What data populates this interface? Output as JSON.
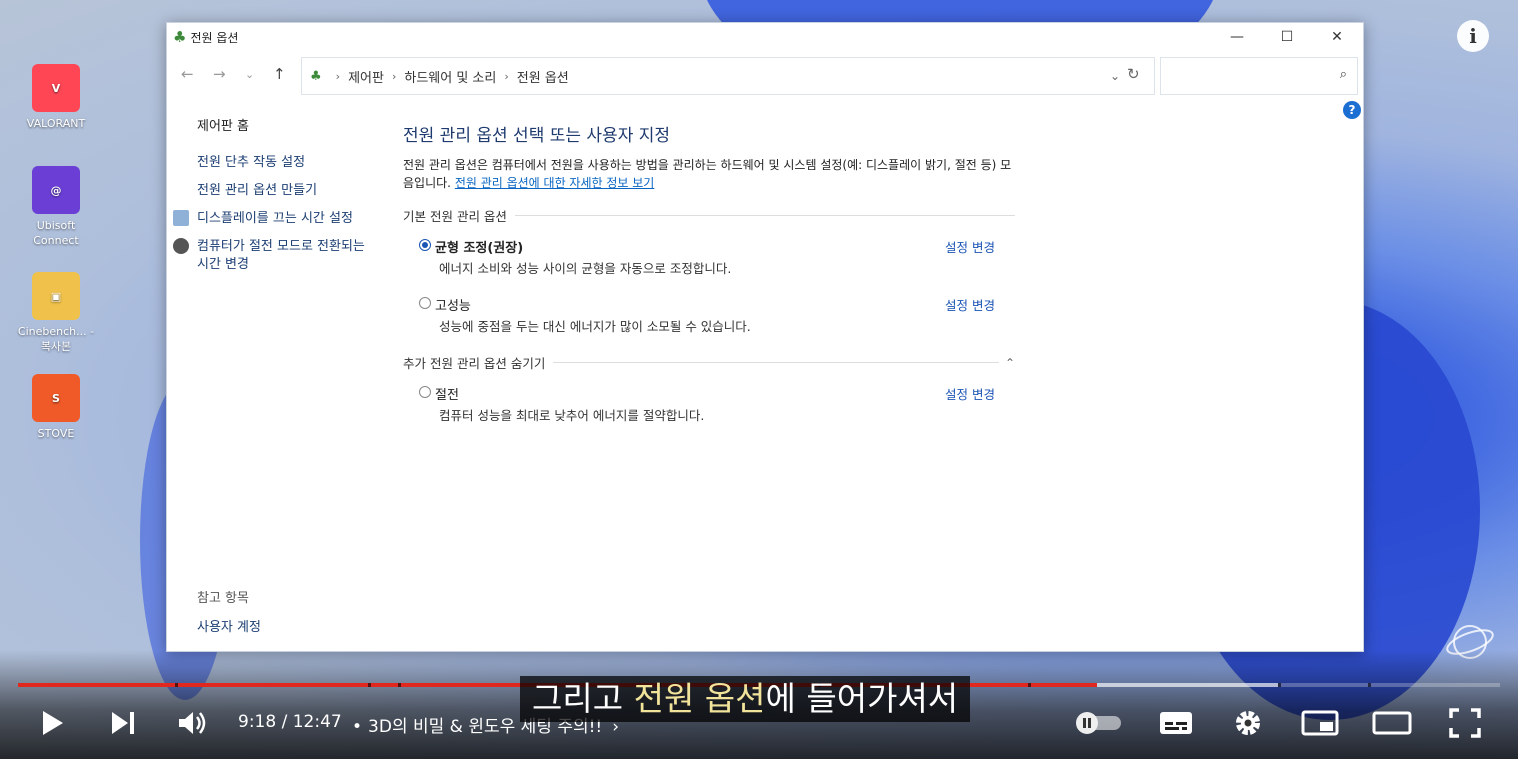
{
  "desktop": {
    "icons": [
      {
        "label": "VALORANT",
        "glyph": "V",
        "color": "#ff4655"
      },
      {
        "label": "Ubisoft Connect",
        "glyph": "@",
        "color": "#6b3fd6"
      },
      {
        "label": "Cinebench... - 복사본",
        "glyph": "▣",
        "color": "#f0c24b"
      },
      {
        "label": "STOVE",
        "glyph": "S",
        "color": "#f05a28"
      }
    ]
  },
  "window": {
    "title": "전원 옵션",
    "controls": {
      "minimize": "—",
      "maximize": "☐",
      "close": "✕"
    },
    "address": [
      "제어판",
      "하드웨어 및 소리",
      "전원 옵션"
    ]
  },
  "sidebar": {
    "home": "제어판 홈",
    "links": [
      "전원 단추 작동 설정",
      "전원 관리 옵션 만들기",
      "디스플레이를 끄는 시간 설정",
      "컴퓨터가 절전 모드로 전환되는 시간 변경"
    ],
    "see_also_heading": "참고 항목",
    "see_also_link": "사용자 계정"
  },
  "main": {
    "heading": "전원 관리 옵션 선택 또는 사용자 지정",
    "description": "전원 관리 옵션은 컴퓨터에서 전원을 사용하는 방법을 관리하는 하드웨어 및 시스템 설정(예: 디스플레이 밝기, 절전 등) 모음입니다.",
    "more_info_link": "전원 관리 옵션에 대한 자세한 정보 보기",
    "basic_group": "기본 전원 관리 옵션",
    "extra_group": "추가 전원 관리 옵션 숨기기",
    "change_label": "설정 변경",
    "plans": [
      {
        "name": "균형 조정(권장)",
        "desc": "에너지 소비와 성능 사이의 균형을 자동으로 조정합니다.",
        "selected": true
      },
      {
        "name": "고성능",
        "desc": "성능에 중점을 두는 대신 에너지가 많이 소모될 수 있습니다.",
        "selected": false
      },
      {
        "name": "절전",
        "desc": "컴퓨터 성능을 최대로 낮추어 에너지를 절약합니다.",
        "selected": false
      }
    ]
  },
  "player": {
    "time": "9:18 / 12:47",
    "chapter": "3D의 비밀 & 윈도우 세팅 주의!!",
    "subtitle_pre": "그리고 ",
    "subtitle_hl": "전원 옵션",
    "subtitle_post": "에 들어가셔서",
    "played_fraction": 0.728,
    "buffered_fraction": 0.85,
    "colors": {
      "played": "#e0281e"
    }
  }
}
